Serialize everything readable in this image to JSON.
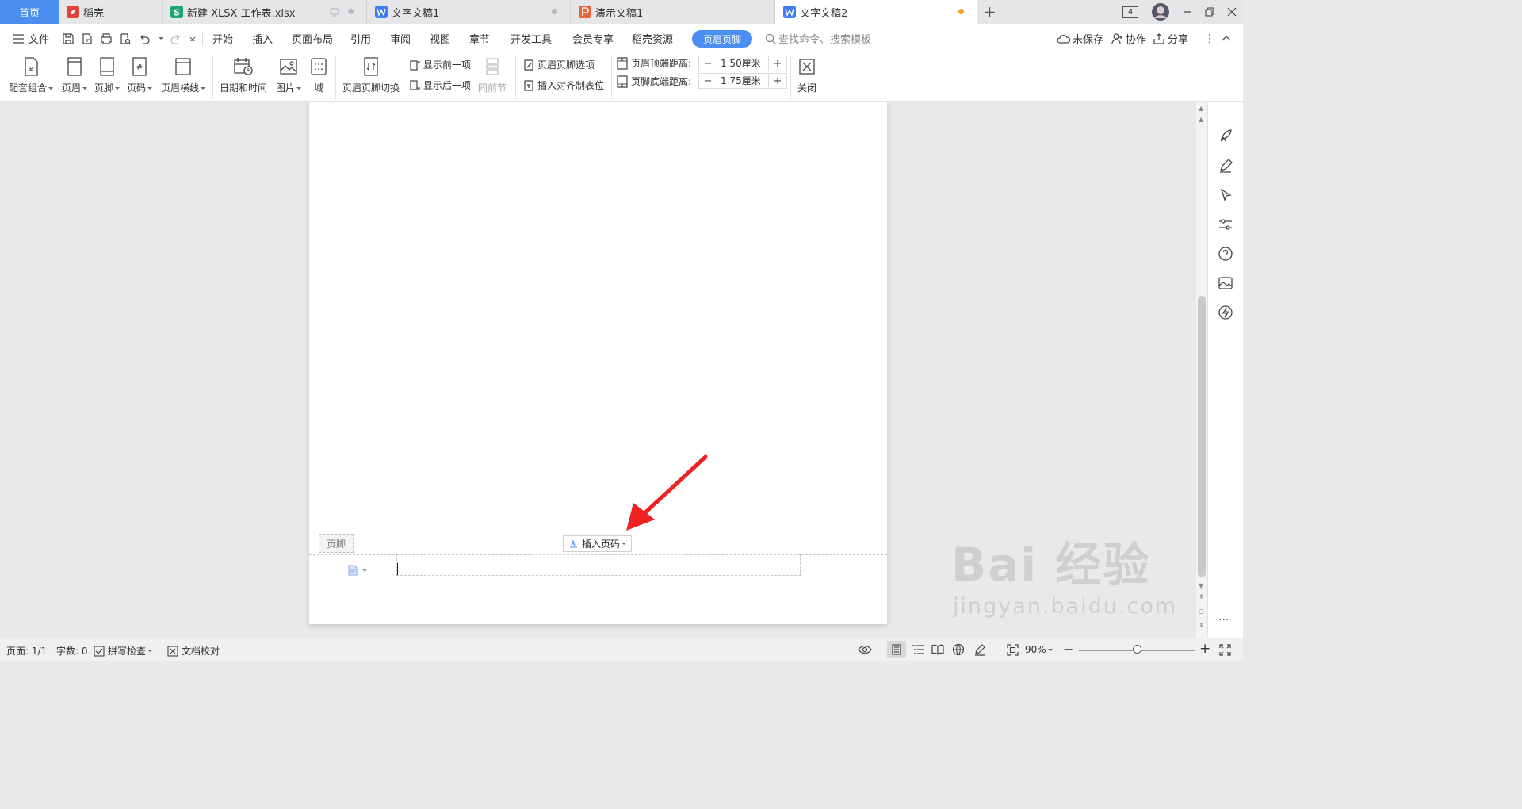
{
  "tabs": {
    "home": "首页",
    "items": [
      {
        "label": "稻壳",
        "icon": "docer-icon",
        "color": "#e0443b"
      },
      {
        "label": "新建 XLSX 工作表.xlsx",
        "icon": "spreadsheet-icon",
        "color": "#1fa672"
      },
      {
        "label": "文字文稿1",
        "icon": "writer-icon",
        "color": "#3f7ef2"
      },
      {
        "label": "演示文稿1",
        "icon": "presentation-icon",
        "color": "#e8663d"
      },
      {
        "label": "文字文稿2",
        "icon": "writer-icon",
        "color": "#3f7ef2",
        "active": true
      }
    ],
    "new_tab": "+",
    "window_count": "4"
  },
  "menubar": {
    "file": "文件",
    "tabs": [
      "开始",
      "插入",
      "页面布局",
      "引用",
      "审阅",
      "视图",
      "章节",
      "开发工具",
      "会员专享",
      "稻壳资源"
    ],
    "active_tab": "页眉页脚",
    "search_placeholder": "查找命令、搜索模板",
    "unsaved": "未保存",
    "collaborate": "协作",
    "share": "分享"
  },
  "ribbon": {
    "combo": "配套组合",
    "header": "页眉",
    "footer": "页脚",
    "page_number": "页码",
    "header_line": "页眉横线",
    "date_time": "日期和时间",
    "picture": "图片",
    "field": "域",
    "switch": "页眉页脚切换",
    "show_prev": "显示前一项",
    "show_next": "显示后一项",
    "same_as_prev": "同前节",
    "hf_options": "页眉页脚选项",
    "insert_align_tab": "插入对齐制表位",
    "header_top_label": "页眉顶端距离:",
    "header_top_value": "1.50厘米",
    "footer_bottom_label": "页脚底端距离:",
    "footer_bottom_value": "1.75厘米",
    "close": "关闭"
  },
  "document": {
    "footer_tag": "页脚",
    "insert_page_number": "插入页码"
  },
  "watermark": {
    "brand": "Bai 经验",
    "url": "jingyan.baidu.com"
  },
  "statusbar": {
    "page": "页面: 1/1",
    "word_count": "字数: 0",
    "spell_check": "拼写检查",
    "doc_proof": "文档校对",
    "zoom": "90%",
    "zoom_level": 0.5
  },
  "colors": {
    "accent": "#4a8ff0",
    "annotation_arrow": "#ee2222"
  }
}
